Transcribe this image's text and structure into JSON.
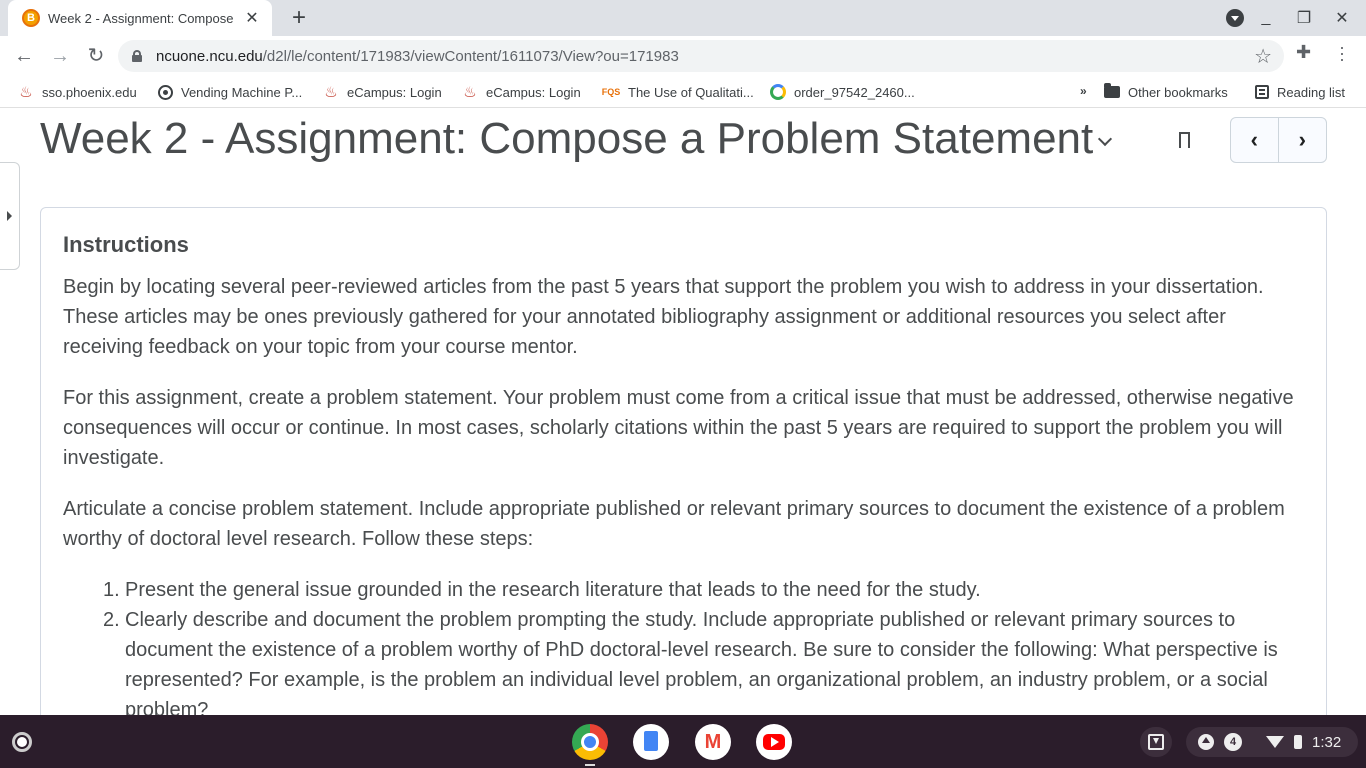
{
  "browser": {
    "tab": {
      "title": "Week 2 - Assignment: Compose",
      "favicon_letter": "B"
    },
    "new_tab_label": "+",
    "url": {
      "host": "ncuone.ncu.edu",
      "path": "/d2l/le/content/171983/viewContent/1611073/View?ou=171983"
    },
    "window": {
      "minimize": "_",
      "restore": "❐",
      "close": "✕"
    }
  },
  "bookmarks": [
    {
      "label": "sso.phoenix.edu",
      "icon": "phoenix-icon"
    },
    {
      "label": "Vending Machine P...",
      "icon": "globe-icon"
    },
    {
      "label": "eCampus: Login",
      "icon": "ecampus-icon"
    },
    {
      "label": "eCampus: Login",
      "icon": "ecampus-icon"
    },
    {
      "label": "The Use of Qualitati...",
      "icon": "fqs-icon",
      "icon_text": "FQS"
    },
    {
      "label": "order_97542_2460...",
      "icon": "order-icon"
    }
  ],
  "bookmarks_more": "»",
  "other_bookmarks": "Other bookmarks",
  "reading_list": "Reading list",
  "page": {
    "title": "Week 2 - Assignment: Compose a Problem Statement",
    "prev_label": "‹",
    "next_label": "›",
    "instructions_heading": "Instructions",
    "paragraphs": [
      "Begin by locating several peer-reviewed articles from the past 5 years that support the problem you wish to address in your dissertation. These articles may be ones previously gathered for your annotated bibliography assignment or additional resources you select after receiving feedback on your topic from your course mentor.",
      "For this assignment, create a problem statement. Your problem must come from a critical issue that must be addressed, otherwise negative consequences will occur or continue.  In most cases, scholarly citations within the past 5 years are required to support the problem you will investigate.",
      "Articulate a concise problem statement. Include appropriate published or relevant primary sources to document the existence of a problem worthy of doctoral level research.  Follow these steps:"
    ],
    "steps": [
      {
        "num": "1.",
        "text": "Present the general issue grounded in the research literature that leads to the need for the study."
      },
      {
        "num": "2.",
        "text": "Clearly describe and document the problem prompting the study. Include appropriate published or relevant primary sources to document the existence of a problem worthy of PhD doctoral-level research.  Be sure to consider the following:  What perspective is represented? For example, is the problem an individual level problem, an organizational problem, an industry problem, or a social problem?"
      }
    ]
  },
  "shelf": {
    "apps": [
      "chrome-icon",
      "docs-icon",
      "gmail-icon",
      "youtube-icon"
    ],
    "gmail_glyph": "M",
    "notification_count": "4",
    "time": "1:32"
  }
}
